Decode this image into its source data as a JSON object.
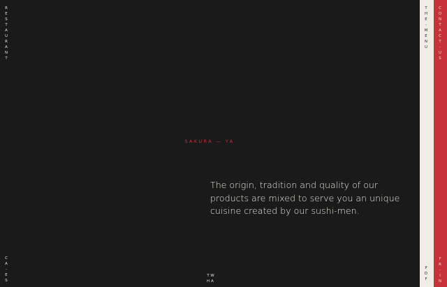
{
  "left_nav": {
    "restaurant_label": "RESTAURANT"
  },
  "language_left": {
    "label": "CA-ES"
  },
  "bottom_center": {
    "label": "TWHA"
  },
  "right_nav": {
    "menu_label": "THE-MENU",
    "pdf_label": "PDF",
    "contact_label": "CONTACT-US",
    "language_label": "FR-IN"
  },
  "hero": {
    "brand": "SAKURA — YA",
    "intro": "The origin, tradition and quality of our products are mixed to serve you an unique cuisine created by our sushi-men."
  },
  "colors": {
    "background": "#1b1a1a",
    "accent_red": "#c7323a",
    "cream": "#f2ede4"
  }
}
